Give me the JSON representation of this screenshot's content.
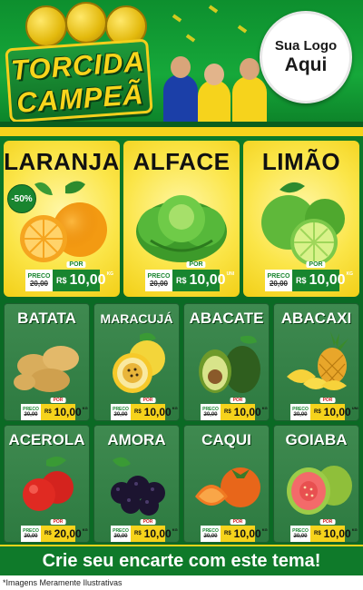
{
  "header": {
    "logo_line1": "TORCIDA",
    "logo_line2": "CAMPEÃ",
    "badge_line1": "Sua Logo",
    "badge_line2": "Aqui"
  },
  "price_tag": {
    "old_label": "PRECO",
    "new_label": "POR",
    "currency": "R$"
  },
  "featured": [
    {
      "name": "LARANJA",
      "discount": "-50%",
      "old_price": "20,00",
      "price": "10,00",
      "unit": "KG",
      "icon": "orange-icon"
    },
    {
      "name": "ALFACE",
      "old_price": "20,00",
      "price": "10,00",
      "unit": "UNI",
      "icon": "lettuce-icon"
    },
    {
      "name": "LIMÃO",
      "old_price": "20,00",
      "price": "10,00",
      "unit": "KG",
      "icon": "lime-icon"
    }
  ],
  "products": [
    {
      "name": "BATATA",
      "old_price": "20,00",
      "price": "10,00",
      "unit": "KG",
      "icon": "potato-icon"
    },
    {
      "name": "MARACUJÁ",
      "old_price": "20,00",
      "price": "10,00",
      "unit": "KG",
      "icon": "passion-fruit-icon"
    },
    {
      "name": "ABACATE",
      "old_price": "20,00",
      "price": "10,00",
      "unit": "KG",
      "icon": "avocado-icon"
    },
    {
      "name": "ABACAXI",
      "old_price": "20,00",
      "price": "10,00",
      "unit": "UNI",
      "icon": "pineapple-icon"
    },
    {
      "name": "ACEROLA",
      "old_price": "20,00",
      "price": "20,00",
      "unit": "KG",
      "icon": "acerola-icon"
    },
    {
      "name": "AMORA",
      "old_price": "20,00",
      "price": "10,00",
      "unit": "KG",
      "icon": "blackberry-icon"
    },
    {
      "name": "CAQUI",
      "old_price": "20,00",
      "price": "10,00",
      "unit": "KG",
      "icon": "persimmon-icon"
    },
    {
      "name": "GOIABA",
      "old_price": "20,00",
      "price": "10,00",
      "unit": "KG",
      "icon": "guava-icon"
    }
  ],
  "footer": {
    "cta": "Crie seu encarte com este tema!",
    "disclaimer": "*Imagens Meramente Ilustrativas"
  },
  "colors": {
    "brand_green": "#0a6a24",
    "accent_yellow": "#f6d31c",
    "price_green": "#18852f"
  }
}
